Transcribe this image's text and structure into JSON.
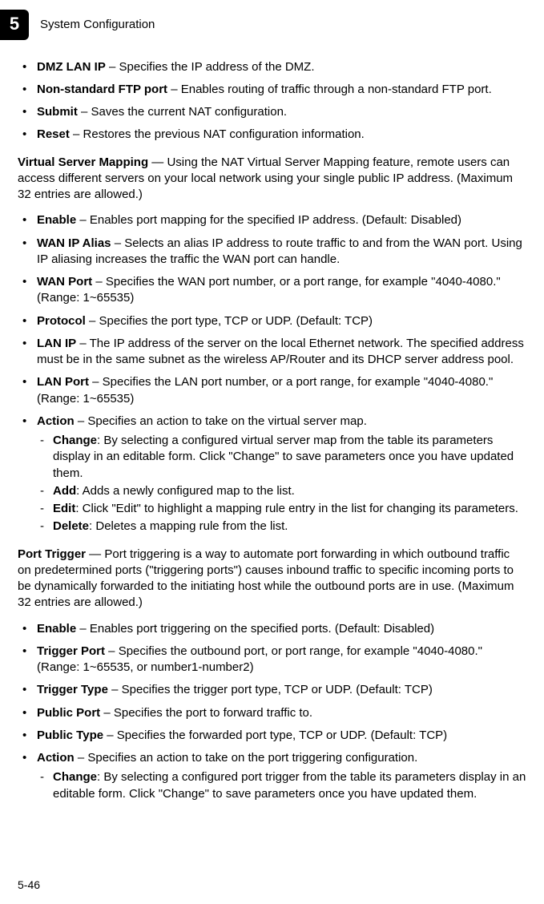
{
  "header": {
    "chapter_number": "5",
    "section_title": "System Configuration"
  },
  "items1": {
    "dmz_label": "DMZ LAN IP",
    "dmz_text": " – Specifies the IP address of the DMZ.",
    "ftp_label": "Non-standard FTP port",
    "ftp_text": " – Enables routing of traffic through a non-standard FTP port.",
    "submit_label": "Submit",
    "submit_text": " – Saves the current NAT configuration.",
    "reset_label": "Reset",
    "reset_text": " – Restores the previous NAT configuration information."
  },
  "vsm": {
    "head_label": "Virtual Server Mapping",
    "head_text": " — Using the NAT Virtual Server Mapping feature, remote users can access different servers on your local network using your single public IP address. (Maximum 32 entries are allowed.)",
    "enable_label": "Enable",
    "enable_text": " – Enables port mapping for the specified IP address. (Default: Disabled)",
    "wanipalias_label": "WAN IP Alias",
    "wanipalias_text": " – Selects an alias IP address to route traffic to and from the WAN port. Using IP aliasing increases the traffic the WAN port can handle.",
    "wanport_label": "WAN Port",
    "wanport_text": " – Specifies the WAN port number, or a port range, for example \"4040-4080.\" (Range: 1~65535)",
    "protocol_label": "Protocol",
    "protocol_text": " – Specifies the port type, TCP or UDP. (Default: TCP)",
    "lanip_label": "LAN IP",
    "lanip_text": " – The IP address of the server on the local Ethernet network. The specified address must be in the same subnet as the wireless AP/Router and its DHCP server address pool.",
    "lanport_label": "LAN Port",
    "lanport_text": " – Specifies the LAN port number, or a port range, for example \"4040-4080.\" (Range: 1~65535)",
    "action_label": "Action",
    "action_text": " – Specifies an action to take on the virtual server map.",
    "change_label": "Change",
    "change_text": ": By selecting a configured virtual server map from the table its parameters display in an editable form. Click \"Change\" to save parameters once you have updated them.",
    "add_label": "Add",
    "add_text": ": Adds a newly configured map to the list.",
    "edit_label": "Edit",
    "edit_text": ": Click \"Edit\" to highlight a mapping rule entry in the list for changing its parameters.",
    "delete_label": "Delete",
    "delete_text": ": Deletes a mapping rule from the list."
  },
  "pt": {
    "head_label": "Port Trigger",
    "head_text": " — Port triggering is a way to automate port forwarding in which outbound traffic on predetermined ports (\"triggering ports\") causes inbound traffic to specific incoming ports to be dynamically forwarded to the initiating host while the outbound ports are in use. (Maximum 32 entries are allowed.)",
    "enable_label": "Enable",
    "enable_text": " – Enables port triggering on the specified ports. (Default: Disabled)",
    "triggerport_label": "Trigger Port",
    "triggerport_text": " – Specifies the outbound port, or port range, for example \"4040-4080.\" (Range: 1~65535, or number1-number2)",
    "triggertype_label": "Trigger Type",
    "triggertype_text": " – Specifies the trigger port type, TCP or UDP. (Default: TCP)",
    "publicport_label": "Public Port",
    "publicport_text": " – Specifies the port to forward traffic to.",
    "publictype_label": "Public Type",
    "publictype_text": " – Specifies the forwarded port type, TCP or UDP. (Default: TCP)",
    "action_label": "Action",
    "action_text": " – Specifies an action to take on the port triggering configuration.",
    "change_label": "Change",
    "change_text": ": By selecting a configured port trigger from the table its parameters display in an editable form. Click \"Change\" to save parameters once you have updated them."
  },
  "page_number": "5-46"
}
